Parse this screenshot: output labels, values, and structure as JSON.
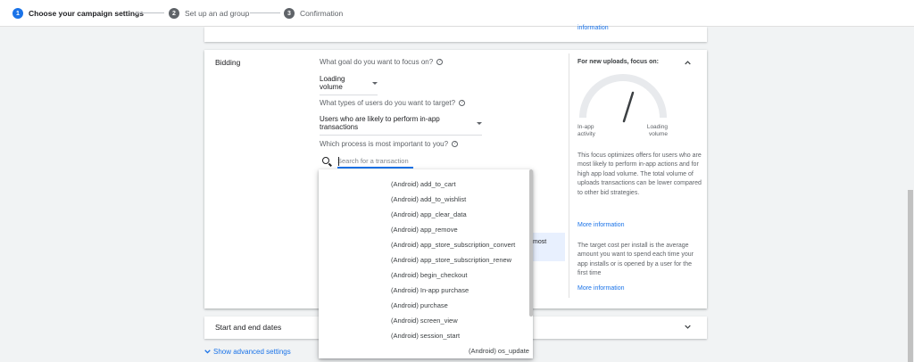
{
  "stepper": {
    "steps": [
      {
        "num": "1",
        "label": "Choose your campaign settings"
      },
      {
        "num": "2",
        "label": "Set up an ad group"
      },
      {
        "num": "3",
        "label": "Confirmation"
      }
    ]
  },
  "top_card": {
    "link": "information"
  },
  "bidding": {
    "section_title": "Bidding",
    "q1": "What goal do you want to focus on?",
    "q1_value": "Loading volume",
    "q2": "What types of users do you want to target?",
    "q2_value": "Users who are likely to perform in-app transactions",
    "q3": "Which process is most important to you?",
    "search_placeholder": "Search for a transaction",
    "behind_text": "most",
    "dropdown_items": [
      "(Android) add_to_cart",
      "(Android) add_to_wishlist",
      "(Android) app_clear_data",
      "(Android) app_remove",
      "(Android) app_store_subscription_convert",
      "(Android) app_store_subscription_renew",
      "(Android) begin_checkout",
      "(Android) In-app purchase",
      "(Android) purchase",
      "(Android) screen_view",
      "(Android) session_start",
      "(Android) os_update"
    ]
  },
  "side": {
    "title": "For new uploads, focus on:",
    "gauge_left": [
      "In-app",
      "activity"
    ],
    "gauge_right": [
      "Loading",
      "volume"
    ],
    "para1": "This focus optimizes offers for users who are most likely to perform in-app actions and for high app load volume. The total volume of uploads transactions can be lower compared to other bid strategies.",
    "link1": "More information",
    "para2": "The target cost per install is the average amount you want to spend each time your app installs or is opened by a user for the first time",
    "link2": "More information"
  },
  "start_end": {
    "title": "Start and end dates"
  },
  "advanced": {
    "label": "Show advanced settings"
  },
  "colors": {
    "accent": "#1a73e8",
    "muted": "#5f6368",
    "panel": "#e8f0fe"
  }
}
